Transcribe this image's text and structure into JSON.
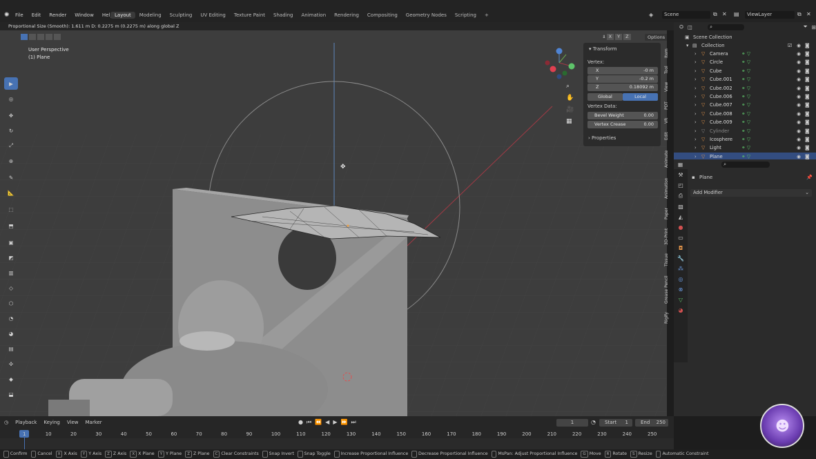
{
  "topbar": {
    "menus": [
      "File",
      "Edit",
      "Render",
      "Window",
      "Help"
    ],
    "workspaces": [
      "Layout",
      "Modeling",
      "Sculpting",
      "UV Editing",
      "Texture Paint",
      "Shading",
      "Animation",
      "Rendering",
      "Compositing",
      "Geometry Nodes",
      "Scripting"
    ],
    "add_tab": "+",
    "scene": "Scene",
    "view_layer": "ViewLayer"
  },
  "status_header": "Proportional Size (Smooth): 1.611 m   D: 0.2275 m (0.2275 m) along global Z",
  "viewport": {
    "perspective": "User Perspective",
    "object": "(1) Plane",
    "header_axes": [
      "X",
      "Y",
      "Z"
    ],
    "options": "Options"
  },
  "npanel": {
    "section": "Transform",
    "vertex_label": "Vertex:",
    "x_label": "X",
    "x_value": "-0 m",
    "y_label": "Y",
    "y_value": "-0.2 m",
    "z_label": "Z",
    "z_value": "0.18092 m",
    "global": "Global",
    "local": "Local",
    "vertex_data": "Vertex Data:",
    "bevel_weight": "Bevel Weight",
    "bevel_weight_value": "0.00",
    "vertex_crease": "Vertex Crease",
    "vertex_crease_value": "0.00",
    "properties": "Properties"
  },
  "sidetabs": [
    "Item",
    "Tool",
    "View",
    "PDT",
    "VR",
    "Edit",
    "Animate",
    "Animation",
    "Paper",
    "3D-Print",
    "Tissue",
    "Grease Pencil",
    "Rigify"
  ],
  "outliner": {
    "root": "Scene Collection",
    "collection": "Collection",
    "items": [
      {
        "name": "Camera",
        "color": "#e0934a"
      },
      {
        "name": "Circle",
        "color": "#e0934a"
      },
      {
        "name": "Cube",
        "color": "#e0934a"
      },
      {
        "name": "Cube.001",
        "color": "#e0934a"
      },
      {
        "name": "Cube.002",
        "color": "#e0934a"
      },
      {
        "name": "Cube.006",
        "color": "#e0934a"
      },
      {
        "name": "Cube.007",
        "color": "#e0934a"
      },
      {
        "name": "Cube.008",
        "color": "#e0934a"
      },
      {
        "name": "Cube.009",
        "color": "#e0934a"
      },
      {
        "name": "Cylinder",
        "color": "#8a8a8a"
      },
      {
        "name": "Icosphere",
        "color": "#e0934a"
      },
      {
        "name": "Light",
        "color": "#e0934a"
      },
      {
        "name": "Plane",
        "color": "#e0934a"
      }
    ]
  },
  "properties": {
    "object_name": "Plane",
    "add_modifier": "Add Modifier"
  },
  "timeline": {
    "menus": [
      "Playback",
      "Keying",
      "View",
      "Marker"
    ],
    "current_frame": "1",
    "start_label": "Start",
    "start": "1",
    "end_label": "End",
    "end": "250",
    "ticks": [
      "1",
      "10",
      "20",
      "30",
      "40",
      "50",
      "60",
      "70",
      "80",
      "90",
      "100",
      "110",
      "120",
      "130",
      "140",
      "150",
      "160",
      "170",
      "180",
      "190",
      "200",
      "210",
      "220",
      "230",
      "240",
      "250"
    ]
  },
  "statusbar": [
    {
      "key": "",
      "label": "Confirm"
    },
    {
      "key": "",
      "label": "Cancel"
    },
    {
      "key": "X",
      "label": "X Axis"
    },
    {
      "key": "Y",
      "label": "Y Axis"
    },
    {
      "key": "Z",
      "label": "Z Axis"
    },
    {
      "key": "X",
      "label": "X Plane"
    },
    {
      "key": "Y",
      "label": "Y Plane"
    },
    {
      "key": "Z",
      "label": "Z Plane"
    },
    {
      "key": "C",
      "label": "Clear Constraints"
    },
    {
      "key": "",
      "label": "Snap Invert"
    },
    {
      "key": "",
      "label": "Snap Toggle"
    },
    {
      "key": "",
      "label": "Increase Proportional Influence"
    },
    {
      "key": "",
      "label": "Decrease Proportional Influence"
    },
    {
      "key": "",
      "label": "MsPan: Adjust Proportional Influence"
    },
    {
      "key": "G",
      "label": "Move"
    },
    {
      "key": "R",
      "label": "Rotate"
    },
    {
      "key": "S",
      "label": "Resize"
    },
    {
      "key": "",
      "label": "Automatic Constraint"
    }
  ],
  "colors": {
    "accent": "#4772b3",
    "orange": "#e0934a",
    "green": "#5ec46a",
    "viewport": "#3d3d3d"
  }
}
